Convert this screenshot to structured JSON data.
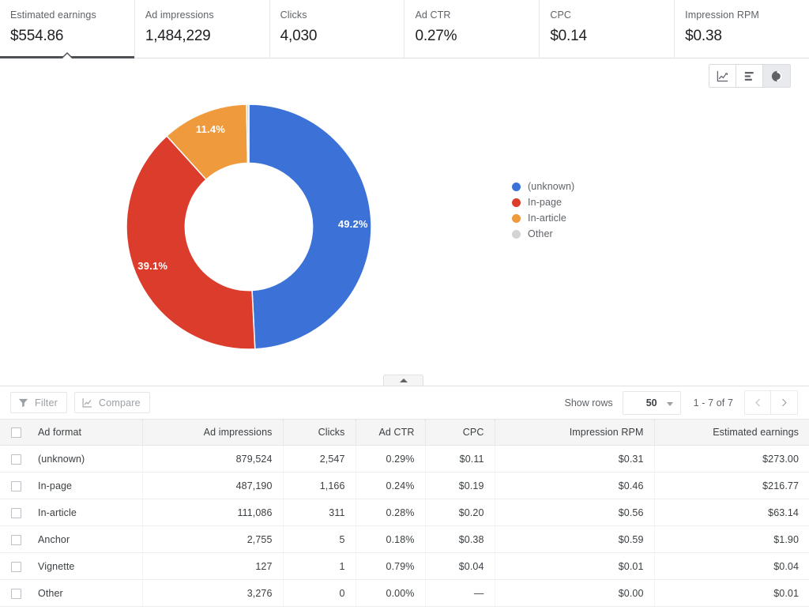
{
  "metrics": [
    {
      "label": "Estimated earnings",
      "value": "$554.86",
      "selected": true
    },
    {
      "label": "Ad impressions",
      "value": "1,484,229",
      "selected": false
    },
    {
      "label": "Clicks",
      "value": "4,030",
      "selected": false
    },
    {
      "label": "Ad CTR",
      "value": "0.27%",
      "selected": false
    },
    {
      "label": "CPC",
      "value": "$0.14",
      "selected": false
    },
    {
      "label": "Impression RPM",
      "value": "$0.38",
      "selected": false
    }
  ],
  "chart_toggle": [
    {
      "icon": "line-chart-icon",
      "name": "line-chart-toggle",
      "active": false
    },
    {
      "icon": "bar-chart-icon",
      "name": "bar-chart-toggle",
      "active": false
    },
    {
      "icon": "pie-chart-icon",
      "name": "pie-chart-toggle",
      "active": true
    }
  ],
  "chart_data": {
    "type": "pie",
    "title": "",
    "donut": true,
    "inner_radius_ratio": 0.52,
    "start_angle_deg": -90,
    "categories": [
      "(unknown)",
      "In-page",
      "In-article",
      "Other"
    ],
    "values": [
      49.2,
      39.1,
      11.4,
      0.3
    ],
    "value_labels": [
      "49.2%",
      "39.1%",
      "11.4%",
      ""
    ],
    "colors": [
      "#3c72d7",
      "#dc3c2c",
      "#ef9a3c",
      "#d0d2d4"
    ],
    "legend": {
      "position": "right",
      "entries": [
        {
          "label": "(unknown)",
          "color": "#3c72d7"
        },
        {
          "label": "In-page",
          "color": "#dc3c2c"
        },
        {
          "label": "In-article",
          "color": "#ef9a3c"
        },
        {
          "label": "Other",
          "color": "#d3d4d6"
        }
      ]
    }
  },
  "splitter": {
    "icon": "collapse-up-arrow-icon"
  },
  "toolbar": {
    "filter_label": "Filter",
    "compare_label": "Compare",
    "show_rows_label": "Show rows",
    "rows_value": "50",
    "page_range": "1 - 7 of 7",
    "prev_label": "‹",
    "next_label": "›"
  },
  "table": {
    "columns": [
      {
        "key": "format",
        "label": "Ad format",
        "align": "left"
      },
      {
        "key": "impressions",
        "label": "Ad impressions",
        "align": "right"
      },
      {
        "key": "clicks",
        "label": "Clicks",
        "align": "right"
      },
      {
        "key": "ctr",
        "label": "Ad CTR",
        "align": "right"
      },
      {
        "key": "cpc",
        "label": "CPC",
        "align": "right"
      },
      {
        "key": "rpm",
        "label": "Impression RPM",
        "align": "right"
      },
      {
        "key": "earnings",
        "label": "Estimated earnings",
        "align": "right"
      }
    ],
    "rows": [
      {
        "format": "(unknown)",
        "impressions": "879,524",
        "clicks": "2,547",
        "ctr": "0.29%",
        "cpc": "$0.11",
        "rpm": "$0.31",
        "earnings": "$273.00"
      },
      {
        "format": "In-page",
        "impressions": "487,190",
        "clicks": "1,166",
        "ctr": "0.24%",
        "cpc": "$0.19",
        "rpm": "$0.46",
        "earnings": "$216.77"
      },
      {
        "format": "In-article",
        "impressions": "111,086",
        "clicks": "311",
        "ctr": "0.28%",
        "cpc": "$0.20",
        "rpm": "$0.56",
        "earnings": "$63.14"
      },
      {
        "format": "Anchor",
        "impressions": "2,755",
        "clicks": "5",
        "ctr": "0.18%",
        "cpc": "$0.38",
        "rpm": "$0.59",
        "earnings": "$1.90"
      },
      {
        "format": "Vignette",
        "impressions": "127",
        "clicks": "1",
        "ctr": "0.79%",
        "cpc": "$0.04",
        "rpm": "$0.01",
        "earnings": "$0.04"
      },
      {
        "format": "Other",
        "impressions": "3,276",
        "clicks": "0",
        "ctr": "0.00%",
        "cpc": "—",
        "rpm": "$0.00",
        "earnings": "$0.01"
      }
    ]
  }
}
